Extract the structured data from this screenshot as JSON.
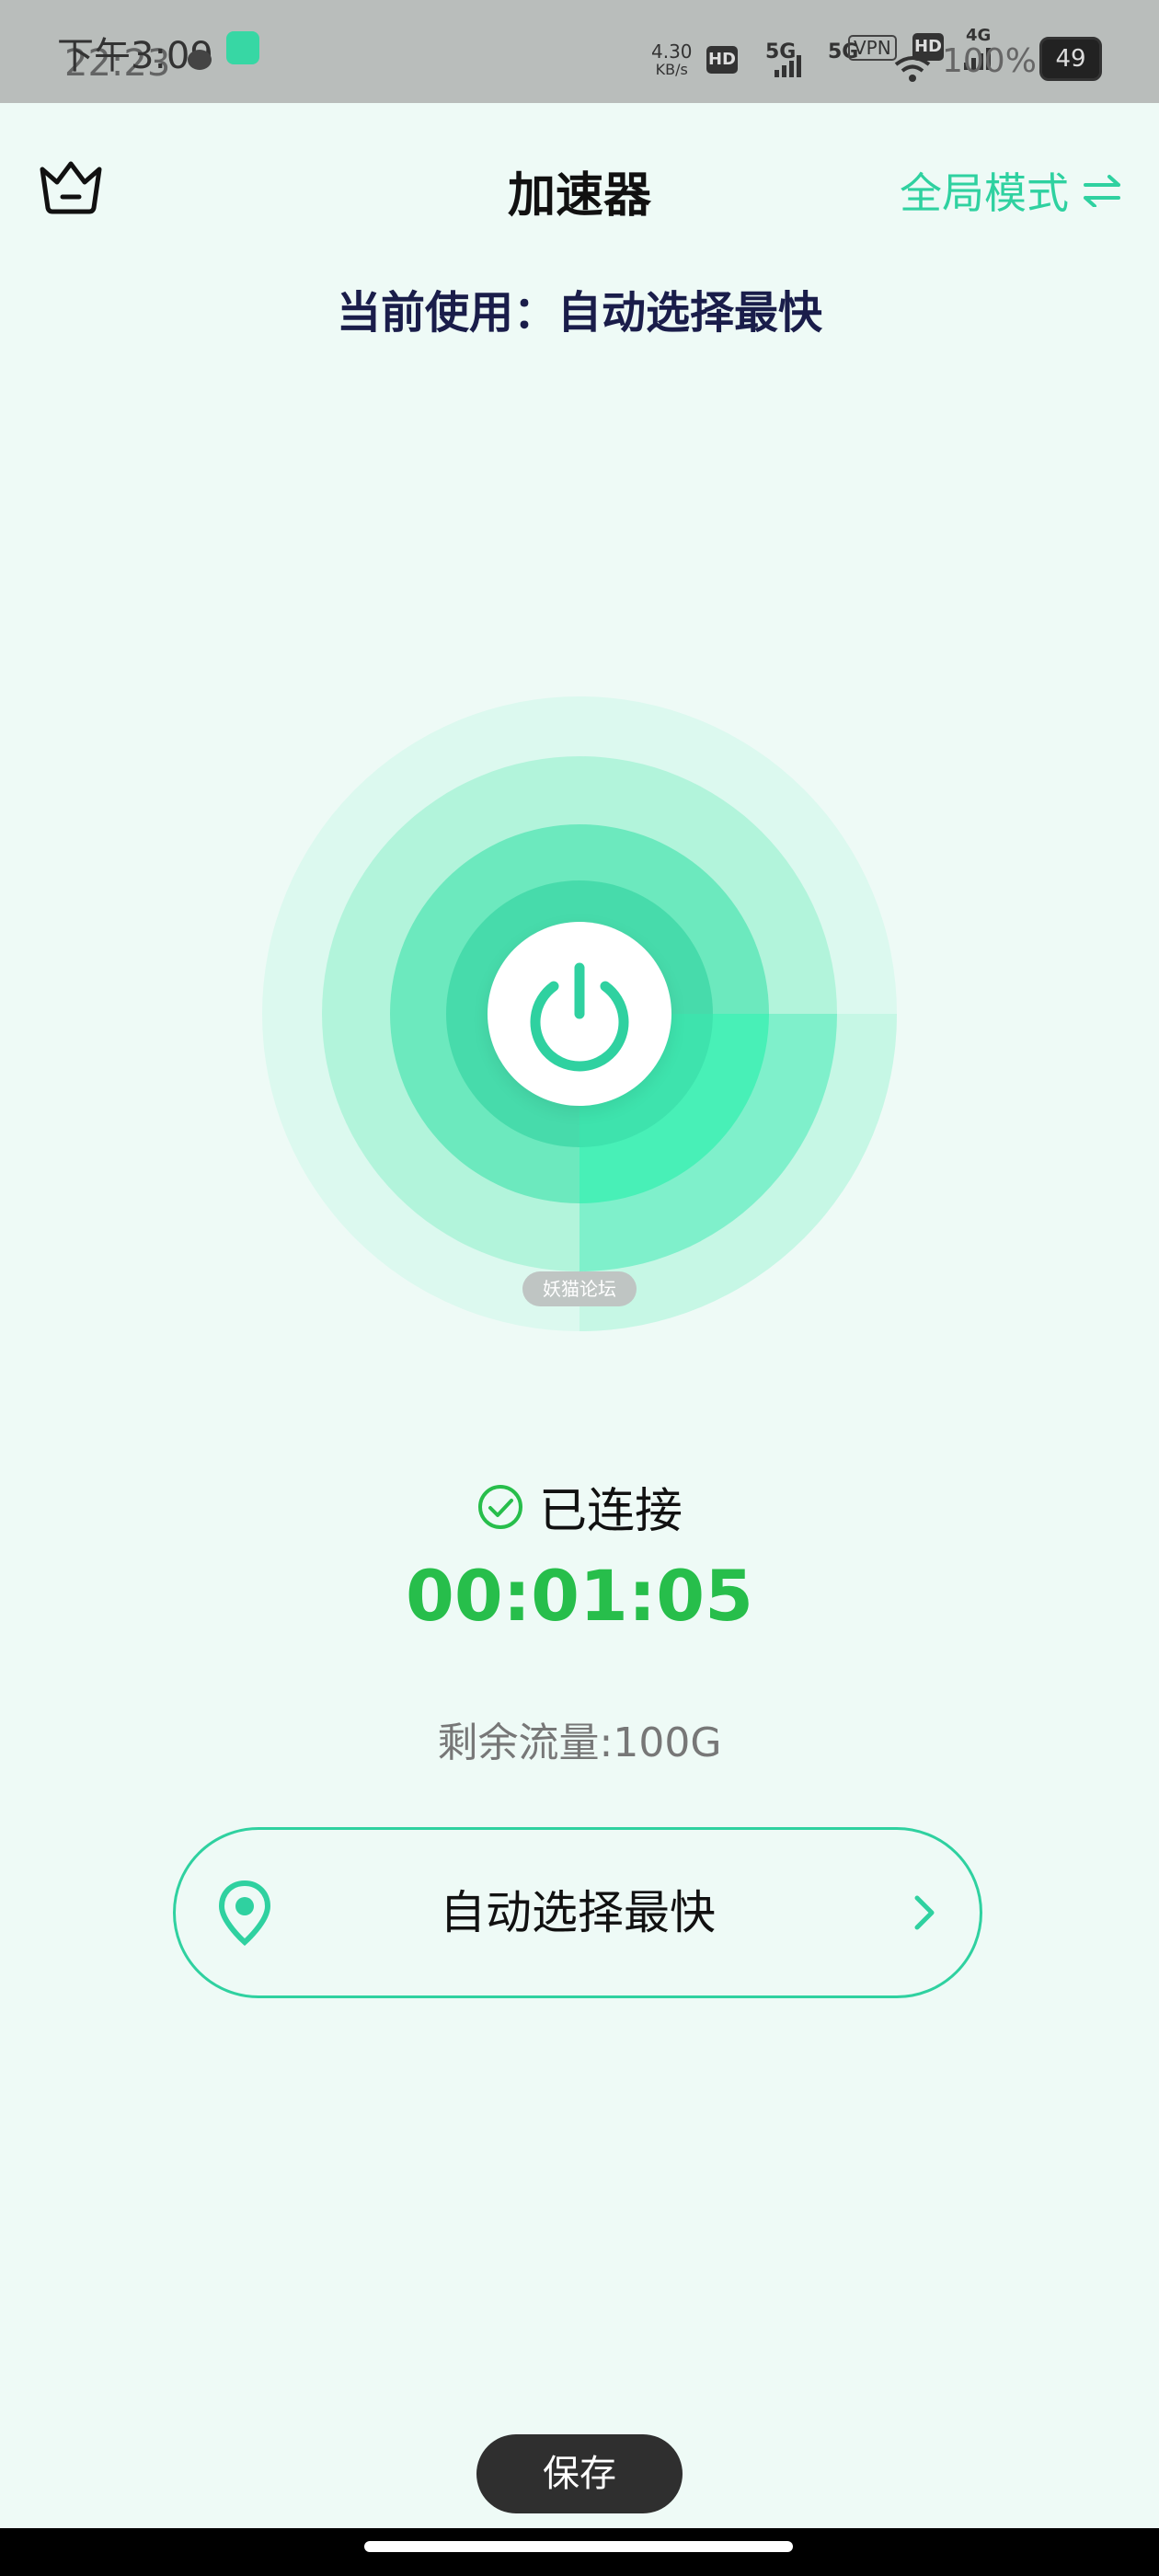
{
  "status_bar": {
    "time_primary": "下午3:09",
    "time_overlay": "22:23",
    "network_speed": "4.30",
    "network_speed_unit": "KB/s",
    "hd_badge": "HD",
    "signal_5g_1": "5G",
    "signal_5g_2": "5G",
    "vpn_badge": "VPN",
    "hd_badge_2": "HD",
    "signal_4g": "4G",
    "battery_percent_overlay": "100%",
    "battery_level": "49"
  },
  "header": {
    "title": "加速器",
    "mode_label": "全局模式",
    "current_server_label": "当前使用：自动选择最快"
  },
  "connection": {
    "status": "已连接",
    "elapsed_time": "00:01:05",
    "remaining_traffic": "剩余流量:100G",
    "watermark": "妖猫论坛"
  },
  "server_selector": {
    "label": "自动选择最快"
  },
  "footer": {
    "save_label": "保存"
  },
  "colors": {
    "accent": "#2fd1a0",
    "connected_green": "#27be4b",
    "background": "#eefaf6"
  },
  "icons": {
    "crown": "crown-icon",
    "mode_switch": "swap-arrows-icon",
    "power": "power-icon",
    "connected_check": "check-circle-icon",
    "location": "location-pin-icon",
    "chevron": "chevron-right-icon"
  }
}
